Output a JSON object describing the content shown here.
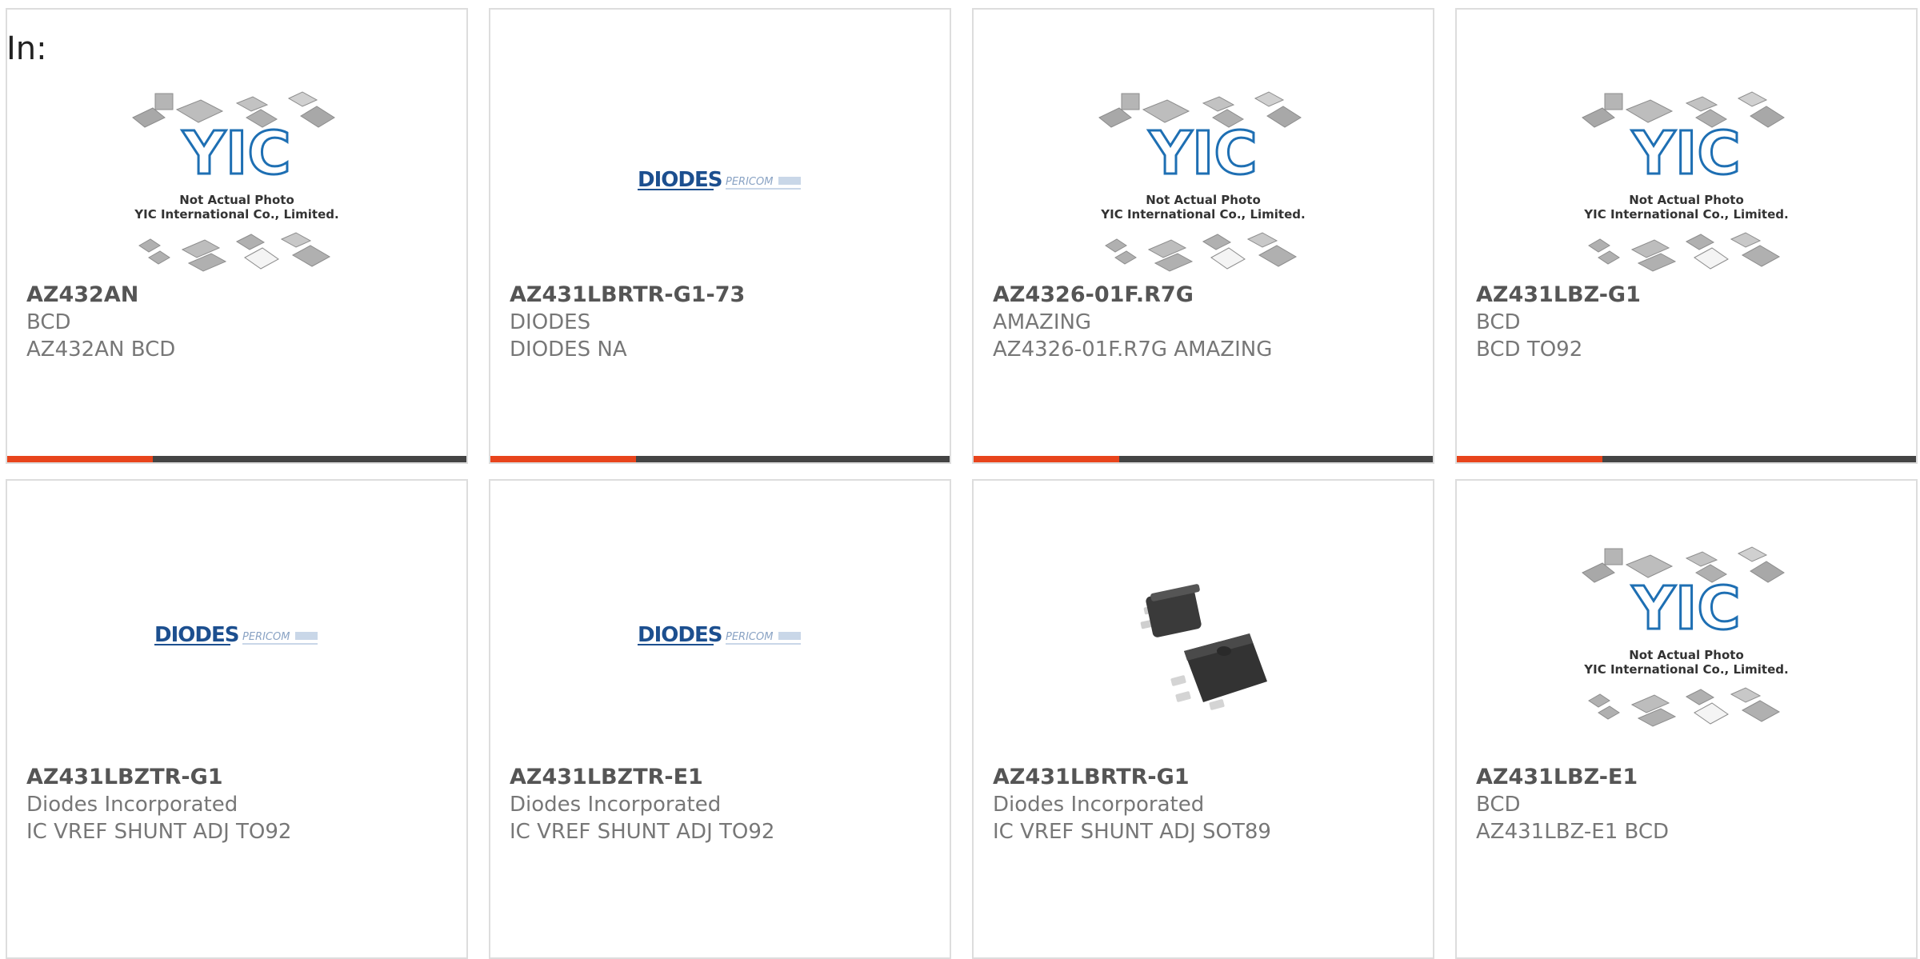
{
  "page": {
    "in_label": "In:"
  },
  "accent_color": "#e8441c",
  "cards": [
    {
      "part": "AZ432AN",
      "manufacturer": "BCD",
      "description": "AZ432AN BCD",
      "image": "yic-placeholder",
      "yic_line1": "Not Actual Photo",
      "yic_line2": "YIC International Co., Limited."
    },
    {
      "part": "AZ431LBRTR-G1-73",
      "manufacturer": "DIODES",
      "description": "DIODES NA",
      "image": "diodes-logo",
      "logo_main": "DIODES",
      "logo_sub": "PERICOM"
    },
    {
      "part": "AZ4326-01F.R7G",
      "manufacturer": "AMAZING",
      "description": "AZ4326-01F.R7G AMAZING",
      "image": "yic-placeholder",
      "yic_line1": "Not Actual Photo",
      "yic_line2": "YIC International Co., Limited."
    },
    {
      "part": "AZ431LBZ-G1",
      "manufacturer": "BCD",
      "description": "BCD TO92",
      "image": "yic-placeholder",
      "yic_line1": "Not Actual Photo",
      "yic_line2": "YIC International Co., Limited."
    },
    {
      "part": "AZ431LBZTR-G1",
      "manufacturer": "Diodes Incorporated",
      "description": "IC VREF SHUNT ADJ TO92",
      "image": "diodes-logo",
      "logo_main": "DIODES",
      "logo_sub": "PERICOM"
    },
    {
      "part": "AZ431LBZTR-E1",
      "manufacturer": "Diodes Incorporated",
      "description": "IC VREF SHUNT ADJ TO92",
      "image": "diodes-logo",
      "logo_main": "DIODES",
      "logo_sub": "PERICOM"
    },
    {
      "part": "AZ431LBRTR-G1",
      "manufacturer": "Diodes Incorporated",
      "description": "IC VREF SHUNT ADJ SOT89",
      "image": "sot89-photo"
    },
    {
      "part": "AZ431LBZ-E1",
      "manufacturer": "BCD",
      "description": "AZ431LBZ-E1 BCD",
      "image": "yic-placeholder",
      "yic_line1": "Not Actual Photo",
      "yic_line2": "YIC International Co., Limited."
    }
  ]
}
